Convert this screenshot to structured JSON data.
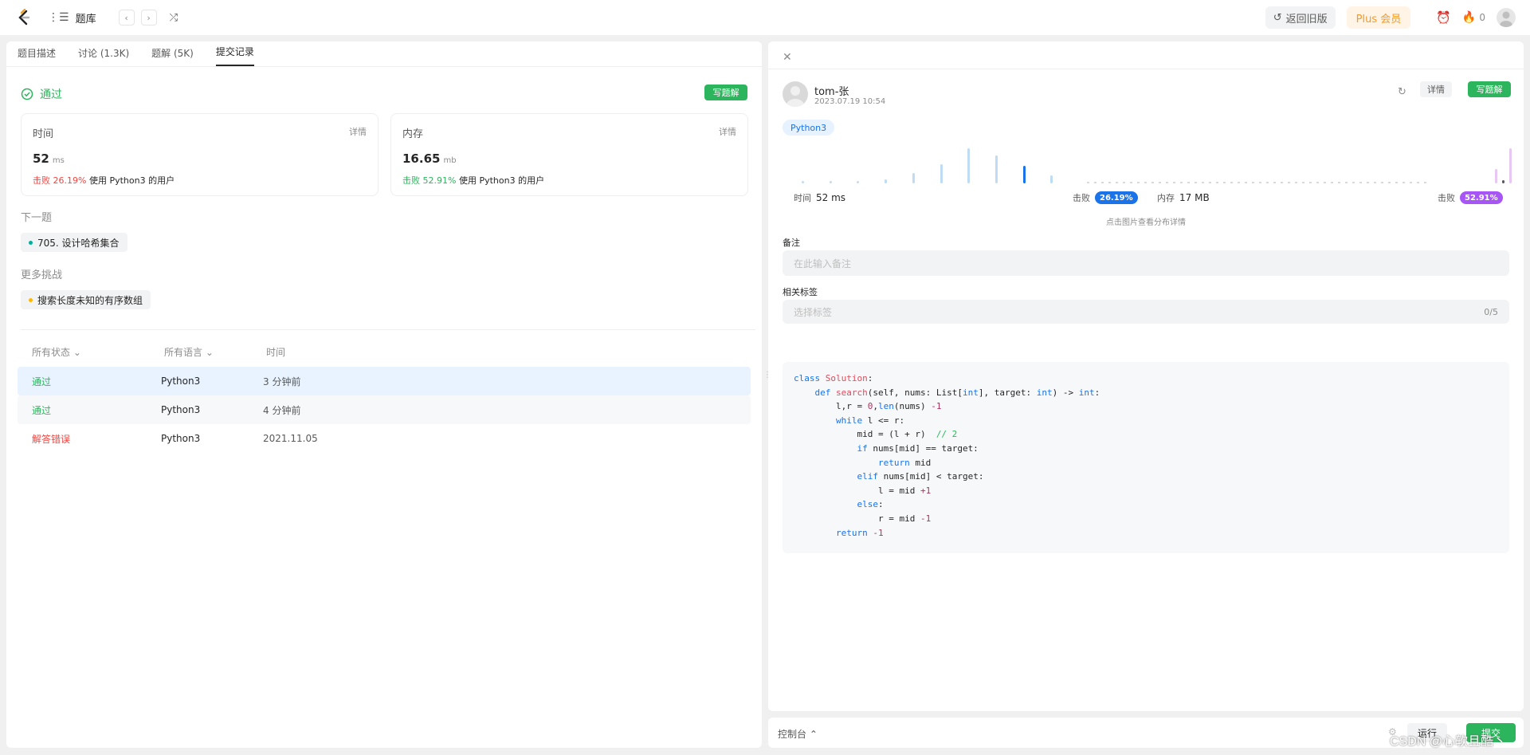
{
  "topbar": {
    "title": "题库",
    "old_version": "返回旧版",
    "plus": "Plus 会员",
    "streak": "0"
  },
  "left": {
    "tabs": [
      "题目描述",
      "讨论 (1.3K)",
      "题解 (5K)",
      "提交记录"
    ],
    "active_tab": 3,
    "status": "通过",
    "write_solution": "写题解",
    "time_card": {
      "label": "时间",
      "detail": "详情",
      "value": "52",
      "unit": "ms",
      "beat": "击败 26.19%",
      "suffix": "使用 Python3 的用户"
    },
    "mem_card": {
      "label": "内存",
      "detail": "详情",
      "value": "16.65",
      "unit": "mb",
      "beat": "击败 52.91%",
      "suffix": "使用 Python3 的用户"
    },
    "next_label": "下一题",
    "next_problem": "705. 设计哈希集合",
    "more_label": "更多挑战",
    "more_problem": "搜索长度未知的有序数组",
    "table": {
      "headers": [
        "所有状态",
        "所有语言",
        "时间"
      ],
      "rows": [
        {
          "status": "通过",
          "lang": "Python3",
          "time": "3 分钟前"
        },
        {
          "status": "通过",
          "lang": "Python3",
          "time": "4 分钟前"
        },
        {
          "status": "解答错误",
          "lang": "Python3",
          "time": "2021.11.05"
        }
      ]
    }
  },
  "right": {
    "user": "tom-张",
    "date": "2023.07.19 10:54",
    "detail": "详情",
    "write_solution": "写题解",
    "lang": "Python3",
    "time_label": "时间",
    "time_value": "52 ms",
    "beat_label": "击败",
    "time_beat": "26.19%",
    "mem_label": "内存",
    "mem_value": "17 MB",
    "mem_beat": "52.91%",
    "hint": "点击图片查看分布详情",
    "note_label": "备注",
    "note_placeholder": "在此输入备注",
    "tags_label": "相关标签",
    "tags_placeholder": "选择标签",
    "tags_count": "0/5",
    "time_distribution": [
      0.05,
      0.05,
      0.06,
      0.12,
      0.3,
      0.55,
      1.0,
      0.8,
      0.5,
      0.22
    ],
    "time_highlight_index": 8,
    "mem_distribution_tail": [
      0.4,
      1.0
    ],
    "colors": {
      "time_pill": "#1a73e8",
      "mem_pill": "#a855f7"
    }
  },
  "bottom": {
    "console": "控制台",
    "run": "运行",
    "submit": "提交"
  },
  "watermark": "CSDN @心软且酷丶"
}
